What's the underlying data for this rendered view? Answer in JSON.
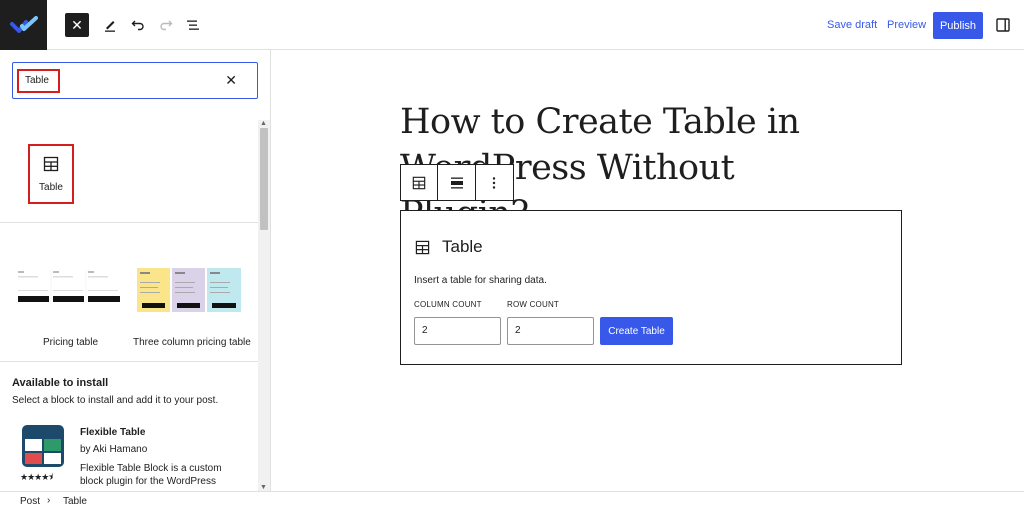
{
  "topbar": {
    "save_draft": "Save draft",
    "preview": "Preview",
    "publish": "Publish",
    "icons": [
      "close-icon",
      "pencil-icon",
      "undo-icon",
      "redo-icon",
      "list-view-icon",
      "settings-sidebar-icon"
    ],
    "accent_color": "#3858e9"
  },
  "inserter": {
    "search_value": "Table",
    "blocks": [
      {
        "label": "Table",
        "icon": "table-icon"
      }
    ],
    "patterns": [
      {
        "label": "Pricing table"
      },
      {
        "label": "Three column pricing table"
      }
    ],
    "available": {
      "title": "Available to install",
      "description": "Select a block to install and add it to your post.",
      "plugin": {
        "name": "Flexible Table",
        "author": "by Aki Hamano",
        "description": "Flexible Table Block is a custom block plugin for the WordPress",
        "rating_stars": 4.5
      }
    }
  },
  "editor": {
    "title": "How to Create Table in WordPress Without Plugin?",
    "placeholder": {
      "title": "Table",
      "instructions": "Insert a table for sharing data.",
      "column_label": "COLUMN COUNT",
      "row_label": "ROW COUNT",
      "column_value": "2",
      "row_value": "2",
      "create_button": "Create Table"
    }
  },
  "breadcrumb": [
    "Post",
    "Table"
  ]
}
